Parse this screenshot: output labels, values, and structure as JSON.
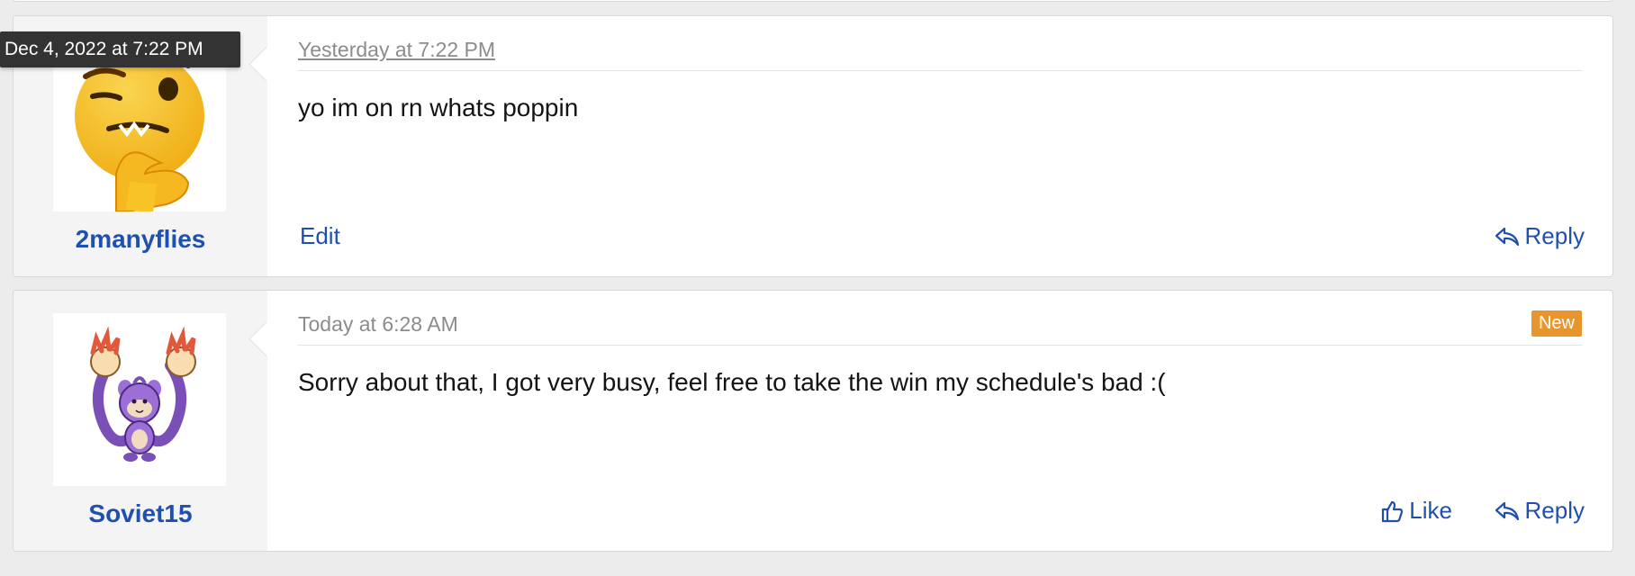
{
  "tooltip": {
    "text": "Dec 4, 2022 at 7:22 PM"
  },
  "posts": [
    {
      "username": "2manyflies",
      "avatar_icon": "thinking-emoji-avatar",
      "date": "Yesterday at 7:22 PM",
      "message": "yo im on rn whats poppin",
      "actions": {
        "edit": "Edit",
        "reply": "Reply"
      }
    },
    {
      "username": "Soviet15",
      "avatar_icon": "ambipom-sprite-avatar",
      "date": "Today at 6:28 AM",
      "badge": "New",
      "message": "Sorry about that, I got very busy, feel free to take the win my schedule's bad :(",
      "actions": {
        "like": "Like",
        "reply": "Reply"
      }
    }
  ],
  "colors": {
    "link": "#1f4fb0",
    "badge": "#e8952c",
    "tooltip_bg": "#333333",
    "page_bg": "#ececec"
  }
}
